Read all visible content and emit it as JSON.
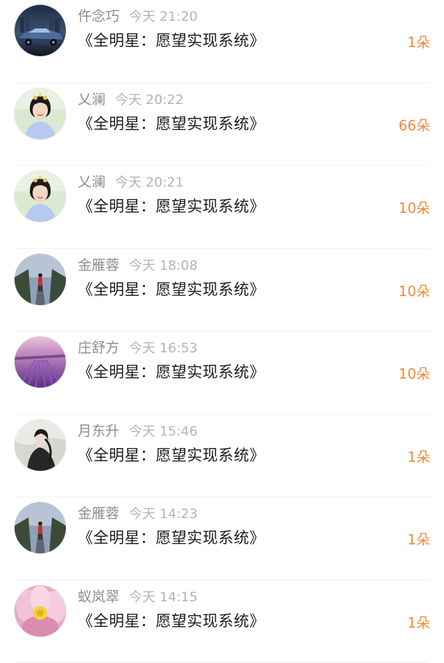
{
  "items": [
    {
      "name": "仵念巧",
      "time": "今天 21:20",
      "title": "《全明星：愿望实现系统》",
      "count": "1朵",
      "avatar_icon": "sports-car-avatar"
    },
    {
      "name": "乂澜",
      "time": "今天 20:22",
      "title": "《全明星：愿望实现系统》",
      "count": "66朵",
      "avatar_icon": "girl-portrait-avatar"
    },
    {
      "name": "乂澜",
      "time": "今天 20:21",
      "title": "《全明星：愿望实现系统》",
      "count": "10朵",
      "avatar_icon": "girl-portrait-avatar"
    },
    {
      "name": "金雁蓉",
      "time": "今天 18:08",
      "title": "《全明星：愿望实现系统》",
      "count": "10朵",
      "avatar_icon": "runner-road-avatar"
    },
    {
      "name": "庄舒方",
      "time": "今天 16:53",
      "title": "《全明星：愿望实现系统》",
      "count": "10朵",
      "avatar_icon": "lavender-field-avatar"
    },
    {
      "name": "月东升",
      "time": "今天 15:46",
      "title": "《全明星：愿望实现系统》",
      "count": "1朵",
      "avatar_icon": "ink-figure-avatar"
    },
    {
      "name": "金雁蓉",
      "time": "今天 14:23",
      "title": "《全明星：愿望实现系统》",
      "count": "1朵",
      "avatar_icon": "runner-road-avatar"
    },
    {
      "name": "蚁岚翠",
      "time": "今天 14:15",
      "title": "《全明星：愿望实现系统》",
      "count": "1朵",
      "avatar_icon": "lotus-flower-avatar"
    }
  ],
  "colors": {
    "accent": "#f08a3a",
    "name": "#8e8e8e",
    "time": "#b3b3b3",
    "title": "#1c1c1c",
    "divider": "#f1f1f1"
  }
}
